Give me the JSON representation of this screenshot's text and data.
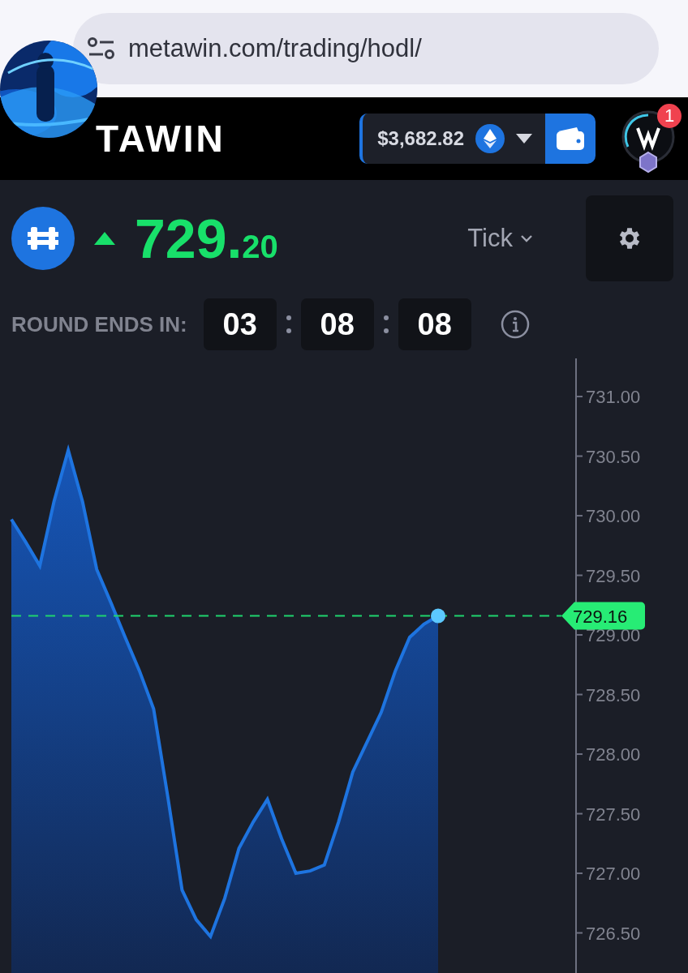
{
  "browser": {
    "url": "metawin.com/trading/hodl/"
  },
  "header": {
    "logo": "TAWIN",
    "balance": "$3,682.82",
    "notifications": "1"
  },
  "ticker": {
    "up": true,
    "price_whole": "729.",
    "price_fraction": "20",
    "interval": "Tick"
  },
  "round": {
    "label": "ROUND ENDS IN:",
    "timer": [
      "03",
      "08",
      "08"
    ]
  },
  "chart": {
    "chart_data": {
      "type": "area",
      "categories": [
        null,
        null,
        null,
        null,
        null,
        null,
        null,
        null,
        null,
        null,
        null,
        null,
        null,
        null,
        null,
        null,
        null,
        null,
        null,
        null,
        null,
        null,
        null,
        null,
        null,
        null,
        null,
        null,
        null,
        null,
        null
      ],
      "series": [
        {
          "color": "#1e74e0",
          "values": [
            729.97,
            729.78,
            729.58,
            730.12,
            730.55,
            730.12,
            729.55,
            729.27,
            728.98,
            728.7,
            728.38,
            727.64,
            726.86,
            726.61,
            726.47,
            726.79,
            727.21,
            727.43,
            727.62,
            727.29,
            727.0,
            727.02,
            727.07,
            727.43,
            727.85,
            728.1,
            728.35,
            728.7,
            728.98,
            729.09,
            729.16
          ]
        }
      ],
      "ylim": [
        726.15,
        731.32
      ],
      "yticks": [
        {
          "value": 731,
          "label": "731.00"
        },
        {
          "value": 730.5,
          "label": "730.50"
        },
        {
          "value": 730,
          "label": "730.00"
        },
        {
          "value": 729.5,
          "label": "729.50"
        },
        {
          "value": 729,
          "label": "729.00"
        },
        {
          "value": 728.5,
          "label": "728.50"
        },
        {
          "value": 728,
          "label": "728.00"
        },
        {
          "value": 727.5,
          "label": "727.50"
        },
        {
          "value": 727,
          "label": "727.00"
        },
        {
          "value": 726.5,
          "label": "726.50"
        }
      ],
      "ref_lines": [
        {
          "axis": "y",
          "value": 729.16,
          "label": "729.16",
          "color": "#1fd46e"
        }
      ]
    }
  }
}
